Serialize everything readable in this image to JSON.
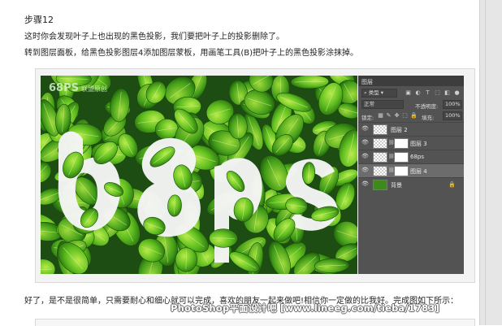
{
  "article": {
    "step_title": "步骤12",
    "paragraph1": "这时你会发现叶子上也出现的黑色投影，我们要把叶子上的投影删除了。",
    "paragraph2": "转到图层面板，给黑色投影图层4添加图层蒙板，用画笔工具(B)把叶子上的黑色投影涂抹掉。",
    "paragraph3": "好了，是不是很简单，只需要耐心和细心就可以完成，喜欢的朋友一起来做吧!相信你一定做的比我好。完成图如下所示："
  },
  "canvas": {
    "logo_text": "68PS",
    "logo_sub": "联盟原创",
    "artwork_text": "68ps"
  },
  "layers_panel": {
    "title": "图层",
    "filter_label": "类型",
    "blend_mode": "正常",
    "opacity_label": "不透明度:",
    "opacity_value": "100%",
    "lock_label": "锁定:",
    "fill_label": "填充:",
    "fill_value": "100%",
    "layers": [
      {
        "name": "图层 2",
        "visible": true,
        "selected": false,
        "thumb": "checker",
        "mask": false,
        "locked": false
      },
      {
        "name": "图层 3",
        "visible": true,
        "selected": false,
        "thumb": "checker",
        "mask": true,
        "locked": false
      },
      {
        "name": "68ps",
        "visible": true,
        "selected": false,
        "thumb": "checker",
        "mask": true,
        "locked": false
      },
      {
        "name": "图层 4",
        "visible": true,
        "selected": true,
        "thumb": "checker",
        "mask": true,
        "locked": false
      },
      {
        "name": "背景",
        "visible": true,
        "selected": false,
        "thumb": "green",
        "mask": false,
        "locked": true
      }
    ]
  },
  "footer_watermark": "PhotoShop平面设计吧 [www.lineeg.com/tieba/1783]",
  "colors": {
    "panel_bg": "#535353",
    "panel_dark": "#3d3d3d",
    "leaf_green": "#3c8a1c",
    "selected_layer": "#6c6c6c"
  }
}
